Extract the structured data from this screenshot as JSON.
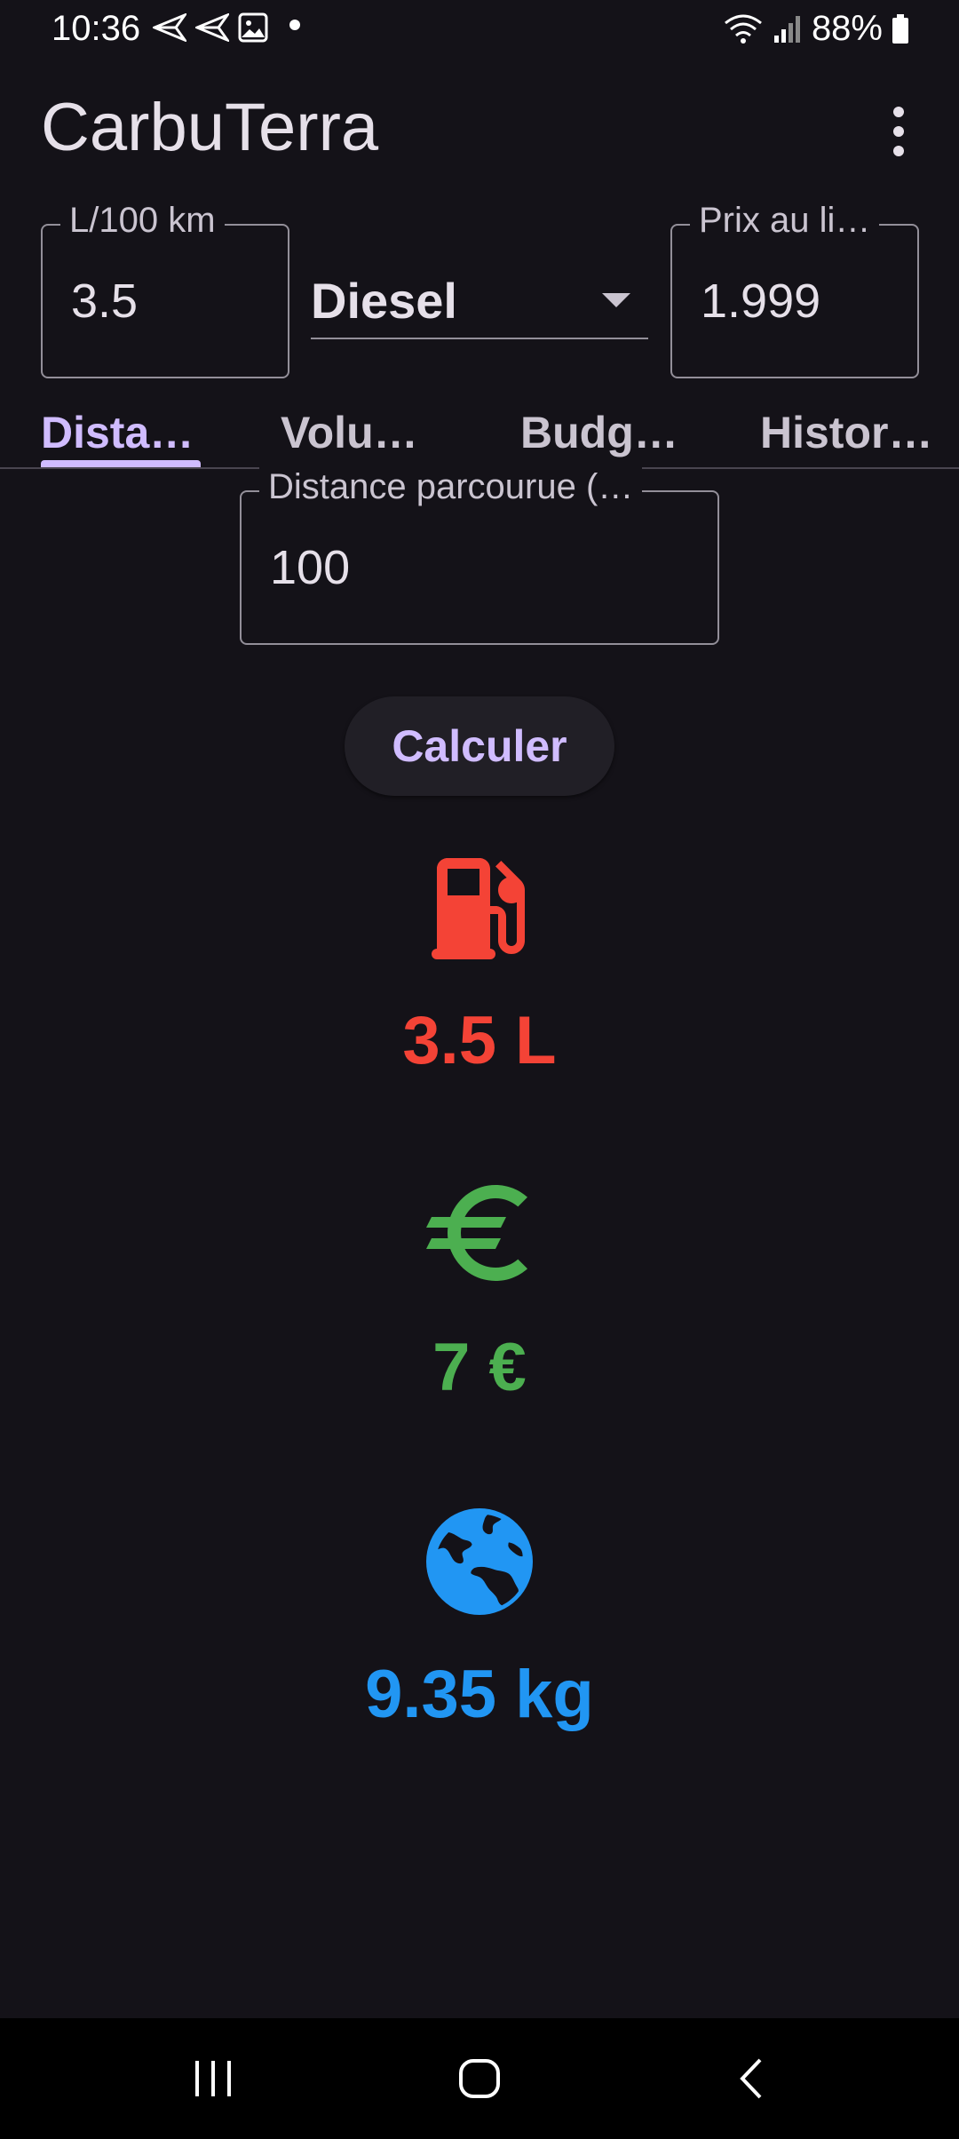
{
  "status_bar": {
    "time": "10:36",
    "battery": "88%"
  },
  "app_bar": {
    "title": "CarbuTerra"
  },
  "inputs": {
    "consumption": {
      "label": "L/100 km",
      "value": "3.5"
    },
    "fuel_type": {
      "value": "Diesel"
    },
    "price": {
      "label": "Prix au li…",
      "value": "1.999"
    }
  },
  "tabs": [
    {
      "label": "Dista…",
      "active": true
    },
    {
      "label": "Volu…"
    },
    {
      "label": "Budg…"
    },
    {
      "label": "Histor…"
    }
  ],
  "distance": {
    "label": "Distance parcourue (…",
    "value": "100"
  },
  "calculate_button": {
    "label": "Calculer"
  },
  "results": {
    "fuel": {
      "icon": "fuel-pump-icon",
      "text": "3.5 L",
      "color": "#F44336"
    },
    "cost": {
      "icon": "euro-icon",
      "text": "7 €",
      "color": "#4CAF50"
    },
    "co2": {
      "icon": "earth-icon",
      "text": "9.35 kg",
      "color": "#2196F3"
    }
  },
  "colors": {
    "background": "#141218",
    "accent": "#D0BCFF"
  }
}
